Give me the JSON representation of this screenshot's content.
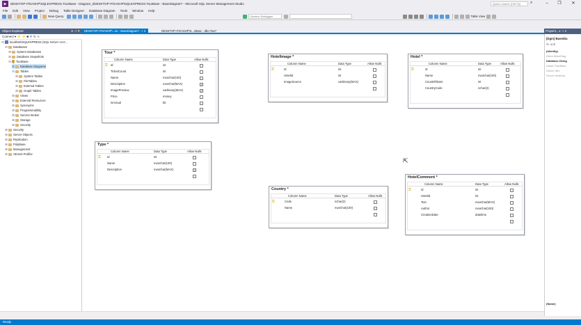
{
  "window": {
    "title": "DESKTOP-ITDASHP\\SQLEXPRESS.TourBase - Diagram_0DESKTOP-ITDASHP\\SQLEXPRESS.TourBase - BaseDiagram* - Microsoft SQL Server Management Studio",
    "quick_launch_placeholder": "Quick Launch (Ctrl+Q)",
    "minimize": "–",
    "maximize": "❐",
    "close": "✕"
  },
  "menu": [
    "File",
    "Edit",
    "View",
    "Project",
    "Debug",
    "Table Designer",
    "Database Diagram",
    "Tools",
    "Window",
    "Help"
  ],
  "toolbar": {
    "new_query": "New Query",
    "debugger_dropdown": "Generic Debugger",
    "table_view": "Table View"
  },
  "object_explorer": {
    "title": "Object Explorer",
    "connect_label": "Connect",
    "tree": [
      {
        "label": "localhost\\SQLEXPRESS (SQL Server 14.0...",
        "level": 0,
        "expanded": true,
        "icon": "server"
      },
      {
        "label": "Databases",
        "level": 1,
        "expanded": true,
        "icon": "folder"
      },
      {
        "label": "System Databases",
        "level": 2,
        "expanded": false,
        "icon": "folder"
      },
      {
        "label": "Database Snapshots",
        "level": 2,
        "expanded": false,
        "icon": "folder"
      },
      {
        "label": "TourBase",
        "level": 2,
        "expanded": true,
        "icon": "db"
      },
      {
        "label": "Database Diagrams",
        "level": 3,
        "expanded": false,
        "icon": "folder",
        "selected": true
      },
      {
        "label": "Tables",
        "level": 3,
        "expanded": true,
        "icon": "folder"
      },
      {
        "label": "System Tables",
        "level": 4,
        "expanded": false,
        "icon": "folder"
      },
      {
        "label": "FileTables",
        "level": 4,
        "expanded": false,
        "icon": "folder"
      },
      {
        "label": "External Tables",
        "level": 4,
        "expanded": false,
        "icon": "folder"
      },
      {
        "label": "Graph Tables",
        "level": 4,
        "expanded": false,
        "icon": "folder"
      },
      {
        "label": "Views",
        "level": 3,
        "expanded": false,
        "icon": "folder"
      },
      {
        "label": "External Resources",
        "level": 3,
        "expanded": false,
        "icon": "folder"
      },
      {
        "label": "Synonyms",
        "level": 3,
        "expanded": false,
        "icon": "folder"
      },
      {
        "label": "Programmability",
        "level": 3,
        "expanded": false,
        "icon": "folder"
      },
      {
        "label": "Service Broker",
        "level": 3,
        "expanded": false,
        "icon": "folder"
      },
      {
        "label": "Storage",
        "level": 3,
        "expanded": false,
        "icon": "folder"
      },
      {
        "label": "Security",
        "level": 3,
        "expanded": false,
        "icon": "folder"
      },
      {
        "label": "Security",
        "level": 1,
        "expanded": false,
        "icon": "folder"
      },
      {
        "label": "Server Objects",
        "level": 1,
        "expanded": false,
        "icon": "folder"
      },
      {
        "label": "Replication",
        "level": 1,
        "expanded": false,
        "icon": "folder"
      },
      {
        "label": "PolyBase",
        "level": 1,
        "expanded": false,
        "icon": "folder"
      },
      {
        "label": "Management",
        "level": 1,
        "expanded": false,
        "icon": "folder"
      },
      {
        "label": "XEvent Profiler",
        "level": 1,
        "expanded": false,
        "icon": "folder"
      }
    ]
  },
  "tabs": [
    {
      "label": "DESKTOP-ITDASHP\\...se - BaseDiagram*",
      "active": true
    },
    {
      "label": "DESKTOP-ITDASHP\\S...rBase - dbo.Tour*",
      "active": false
    }
  ],
  "grid_headers": {
    "column_name": "Column Name",
    "data_type": "Data Type",
    "allow_nulls": "Allow Nulls"
  },
  "tables": [
    {
      "name": "Tour *",
      "rows": [
        {
          "name": "Id",
          "type": "int",
          "nulls": false,
          "key": true
        },
        {
          "name": "TicketCount",
          "type": "int",
          "nulls": false,
          "key": false
        },
        {
          "name": "Name",
          "type": "nvarchar(100)",
          "nulls": false,
          "key": false
        },
        {
          "name": "Description",
          "type": "nvarchar(MAX)",
          "nulls": true,
          "key": false
        },
        {
          "name": "ImagePreview",
          "type": "varbinary(MAX)",
          "nulls": true,
          "key": false
        },
        {
          "name": "Price",
          "type": "money",
          "nulls": false,
          "key": false
        },
        {
          "name": "IsActual",
          "type": "bit",
          "nulls": false,
          "key": false
        },
        {
          "name": "",
          "type": "",
          "nulls": false,
          "key": false
        }
      ]
    },
    {
      "name": "HotelImage *",
      "rows": [
        {
          "name": "Id",
          "type": "int",
          "nulls": false,
          "key": true
        },
        {
          "name": "HotelId",
          "type": "int",
          "nulls": false,
          "key": false
        },
        {
          "name": "ImageSource",
          "type": "varbinary(MAX)",
          "nulls": false,
          "key": false
        },
        {
          "name": "",
          "type": "",
          "nulls": false,
          "key": false
        }
      ]
    },
    {
      "name": "Hotel *",
      "rows": [
        {
          "name": "Id",
          "type": "int",
          "nulls": false,
          "key": true
        },
        {
          "name": "Name",
          "type": "nvarchar(100)",
          "nulls": false,
          "key": false
        },
        {
          "name": "CountOfStars",
          "type": "int",
          "nulls": false,
          "key": false
        },
        {
          "name": "CountryCode",
          "type": "nchar(2)",
          "nulls": false,
          "key": false
        },
        {
          "name": "",
          "type": "",
          "nulls": false,
          "key": false
        }
      ]
    },
    {
      "name": "Type *",
      "rows": [
        {
          "name": "Id",
          "type": "int",
          "nulls": false,
          "key": true
        },
        {
          "name": "Name",
          "type": "nvarchar(100)",
          "nulls": false,
          "key": false
        },
        {
          "name": "Description",
          "type": "nvarchar(MAX)",
          "nulls": true,
          "key": false
        },
        {
          "name": "",
          "type": "",
          "nulls": false,
          "key": false
        }
      ]
    },
    {
      "name": "Country *",
      "rows": [
        {
          "name": "Code",
          "type": "nchar(2)",
          "nulls": false,
          "key": true
        },
        {
          "name": "Name",
          "type": "nvarchar(100)",
          "nulls": false,
          "key": false
        },
        {
          "name": "",
          "type": "",
          "nulls": false,
          "key": false
        }
      ]
    },
    {
      "name": "HotelComment *",
      "rows": [
        {
          "name": "Id",
          "type": "int",
          "nulls": false,
          "key": true
        },
        {
          "name": "HotelId",
          "type": "int",
          "nulls": false,
          "key": false
        },
        {
          "name": "Text",
          "type": "nvarchar(MAX)",
          "nulls": false,
          "key": false
        },
        {
          "name": "Author",
          "type": "nvarchar(100)",
          "nulls": false,
          "key": false
        },
        {
          "name": "CreationDate",
          "type": "datetime",
          "nulls": false,
          "key": false
        },
        {
          "name": "",
          "type": "",
          "nulls": false,
          "key": false
        }
      ]
    }
  ],
  "properties": {
    "title": "Properti...",
    "object": "[Dgm] BaseDia",
    "rows": [
      {
        "label": "(Identity)",
        "style": "bold"
      },
      {
        "label": "(Nam BaseDiag",
        "style": "grey"
      },
      {
        "label": "Database Desig",
        "style": "bold"
      },
      {
        "label": "Datab TourBase",
        "style": "grey"
      },
      {
        "label": "Owner dbo",
        "style": "grey"
      },
      {
        "label": "Server desktop-",
        "style": "grey"
      }
    ],
    "footer": "(Name)"
  },
  "status": {
    "text": "Ready"
  },
  "colors": {
    "accent": "#007acc",
    "panel_header": "#4d6082",
    "key": "#c9a100"
  }
}
